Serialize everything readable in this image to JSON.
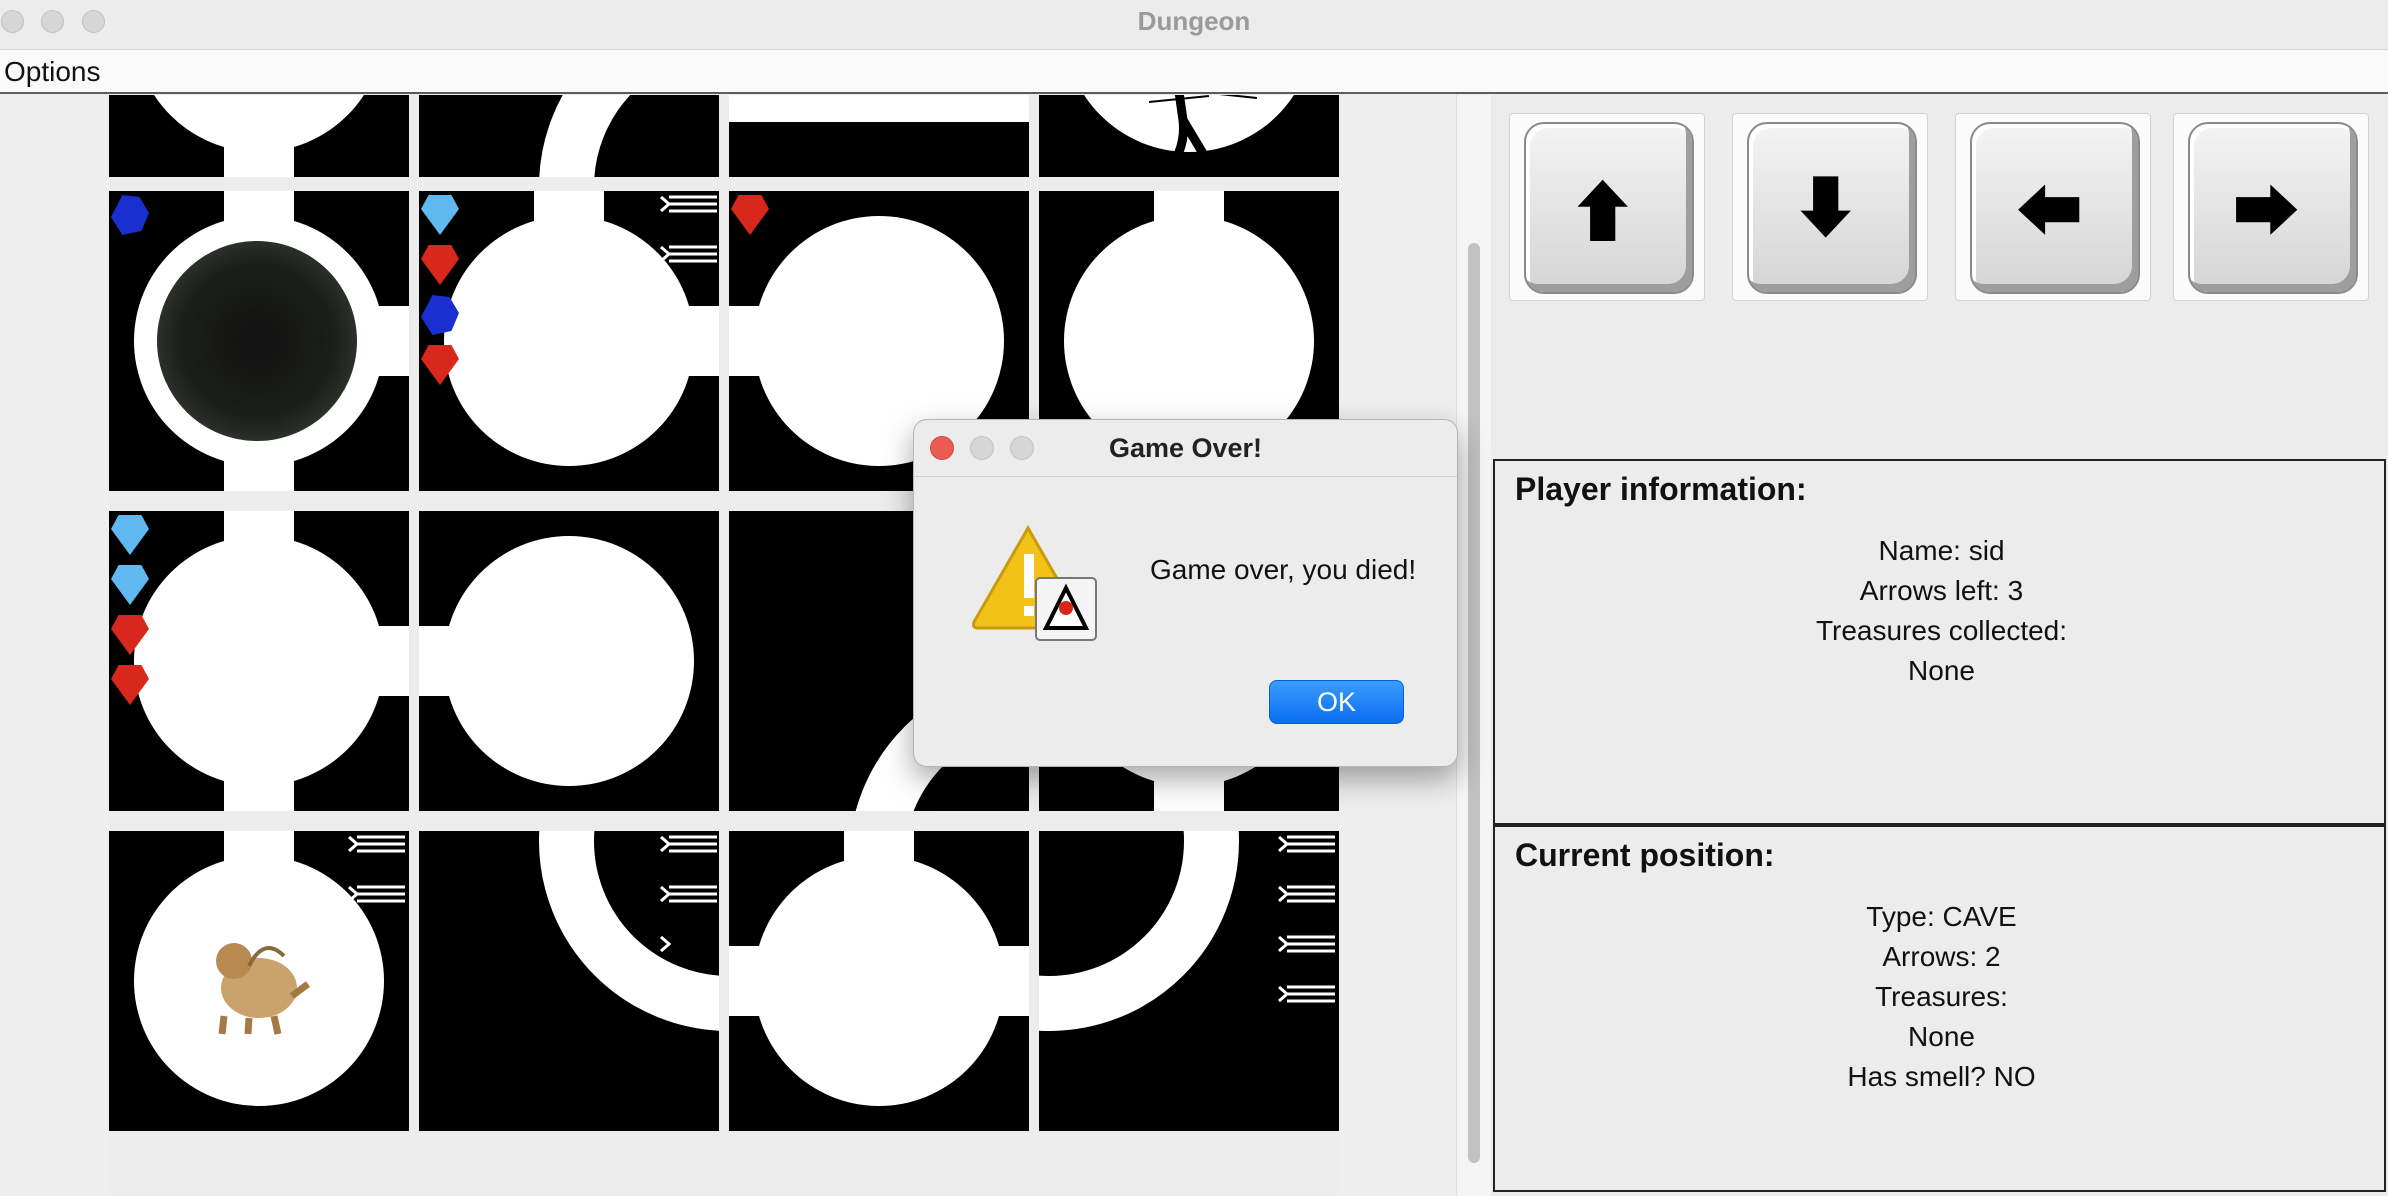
{
  "window": {
    "title": "Dungeon"
  },
  "menu": {
    "options_label": "Options"
  },
  "controls": {
    "up_icon": "arrow-up-icon",
    "down_icon": "arrow-down-icon",
    "left_icon": "arrow-left-icon",
    "right_icon": "arrow-right-icon"
  },
  "player": {
    "heading": "Player information:",
    "name": "Name: sid",
    "arrows": "Arrows left: 3",
    "treasures_label": "Treasures collected:",
    "treasures_value": "None"
  },
  "position": {
    "heading": "Current position:",
    "type": "Type: CAVE",
    "arrows": "Arrows: 2",
    "treasures_label": "Treasures:",
    "treasures_value": "None",
    "smell": "Has smell? NO"
  },
  "dialog": {
    "title": "Game Over!",
    "message": "Game over, you died!",
    "ok_label": "OK",
    "icon": "warning-icon"
  },
  "colors": {
    "ruby": "#d8271c",
    "diamond": "#5fb8f0",
    "sapphire": "#1a2fd0",
    "ok_button": "#0a6ef0"
  }
}
